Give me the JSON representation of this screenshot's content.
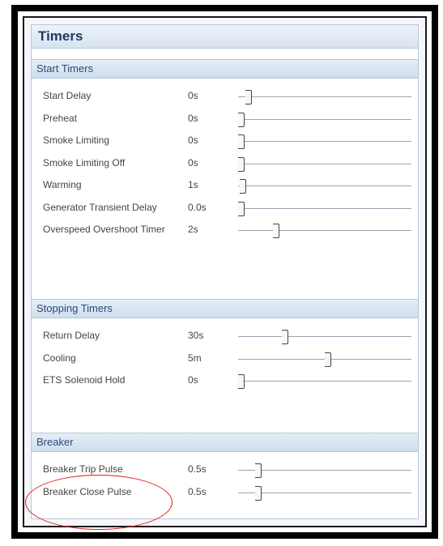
{
  "panel": {
    "title": "Timers"
  },
  "sections": [
    {
      "id": "start",
      "header": "Start Timers",
      "rows": [
        {
          "label": "Start Delay",
          "value": "0s",
          "level": 0.04
        },
        {
          "label": "Preheat",
          "value": "0s",
          "level": 0.0
        },
        {
          "label": "Smoke Limiting",
          "value": "0s",
          "level": 0.0
        },
        {
          "label": "Smoke Limiting Off",
          "value": "0s",
          "level": 0.0
        },
        {
          "label": "Warming",
          "value": "1s",
          "level": 0.01
        },
        {
          "label": "Generator Transient Delay",
          "value": "0.0s",
          "level": 0.0
        },
        {
          "label": "Overspeed Overshoot Timer",
          "value": "2s",
          "level": 0.2
        }
      ]
    },
    {
      "id": "stopping",
      "header": "Stopping Timers",
      "rows": [
        {
          "label": "Return Delay",
          "value": "30s",
          "level": 0.25
        },
        {
          "label": "Cooling",
          "value": "5m",
          "level": 0.5
        },
        {
          "label": "ETS Solenoid Hold",
          "value": "0s",
          "level": 0.0
        }
      ]
    },
    {
      "id": "breaker",
      "header": "Breaker",
      "rows": [
        {
          "label": "Breaker Trip Pulse",
          "value": "0.5s",
          "level": 0.1
        },
        {
          "label": "Breaker Close Pulse",
          "value": "0.5s",
          "level": 0.1
        }
      ]
    }
  ],
  "colors": {
    "annotation": "#e11a1a",
    "accent": "#223a66"
  }
}
